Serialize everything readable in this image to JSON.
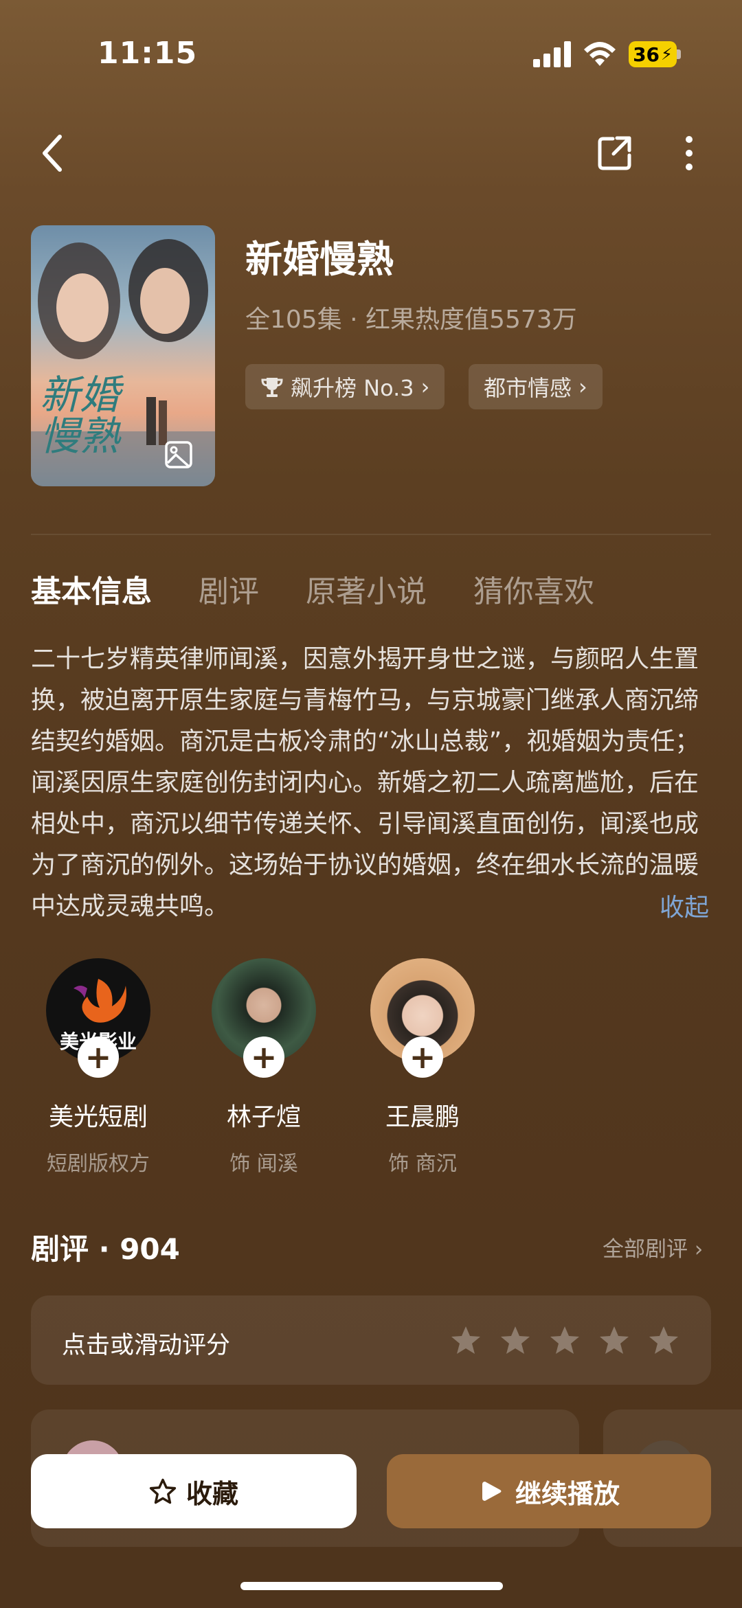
{
  "status": {
    "time": "11:15",
    "battery": "36"
  },
  "drama": {
    "title": "新婚慢熟",
    "meta": "全105集 · 红果热度值5573万",
    "poster_title": "新婚慢熟",
    "tags": [
      {
        "label": "飙升榜 No.3"
      },
      {
        "label": "都市情感"
      }
    ]
  },
  "tabs": [
    "基本信息",
    "剧评",
    "原著小说",
    "猜你喜欢"
  ],
  "synopsis": "二十七岁精英律师闻溪，因意外揭开身世之谜，与颜昭人生置换，被迫离开原生家庭与青梅竹马，与京城豪门继承人商沉缔结契约婚姻。商沉是古板冷肃的“冰山总裁”，视婚姻为责任；闻溪因原生家庭创伤封闭内心。新婚之初二人疏离尴尬，后在相处中，商沉以细节传递关怀、引导闻溪直面创伤，闻溪也成为了商沉的例外。这场始于协议的婚姻，终在细水长流的温暖中达成灵魂共鸣。",
  "collapse_label": "收起",
  "cast": [
    {
      "name": "美光短剧",
      "role": "短剧版权方",
      "logo_text": "美光影业"
    },
    {
      "name": "林子煊",
      "role": "饰 闻溪"
    },
    {
      "name": "王晨鹏",
      "role": "饰 商沉"
    }
  ],
  "reviews": {
    "heading": "剧评 · 904",
    "all_label": "全部剧评",
    "rate_prompt": "点击或滑动评分",
    "rating": 0,
    "max_rating": 5
  },
  "actions": {
    "favorite_label": "收藏",
    "play_label": "继续播放"
  }
}
